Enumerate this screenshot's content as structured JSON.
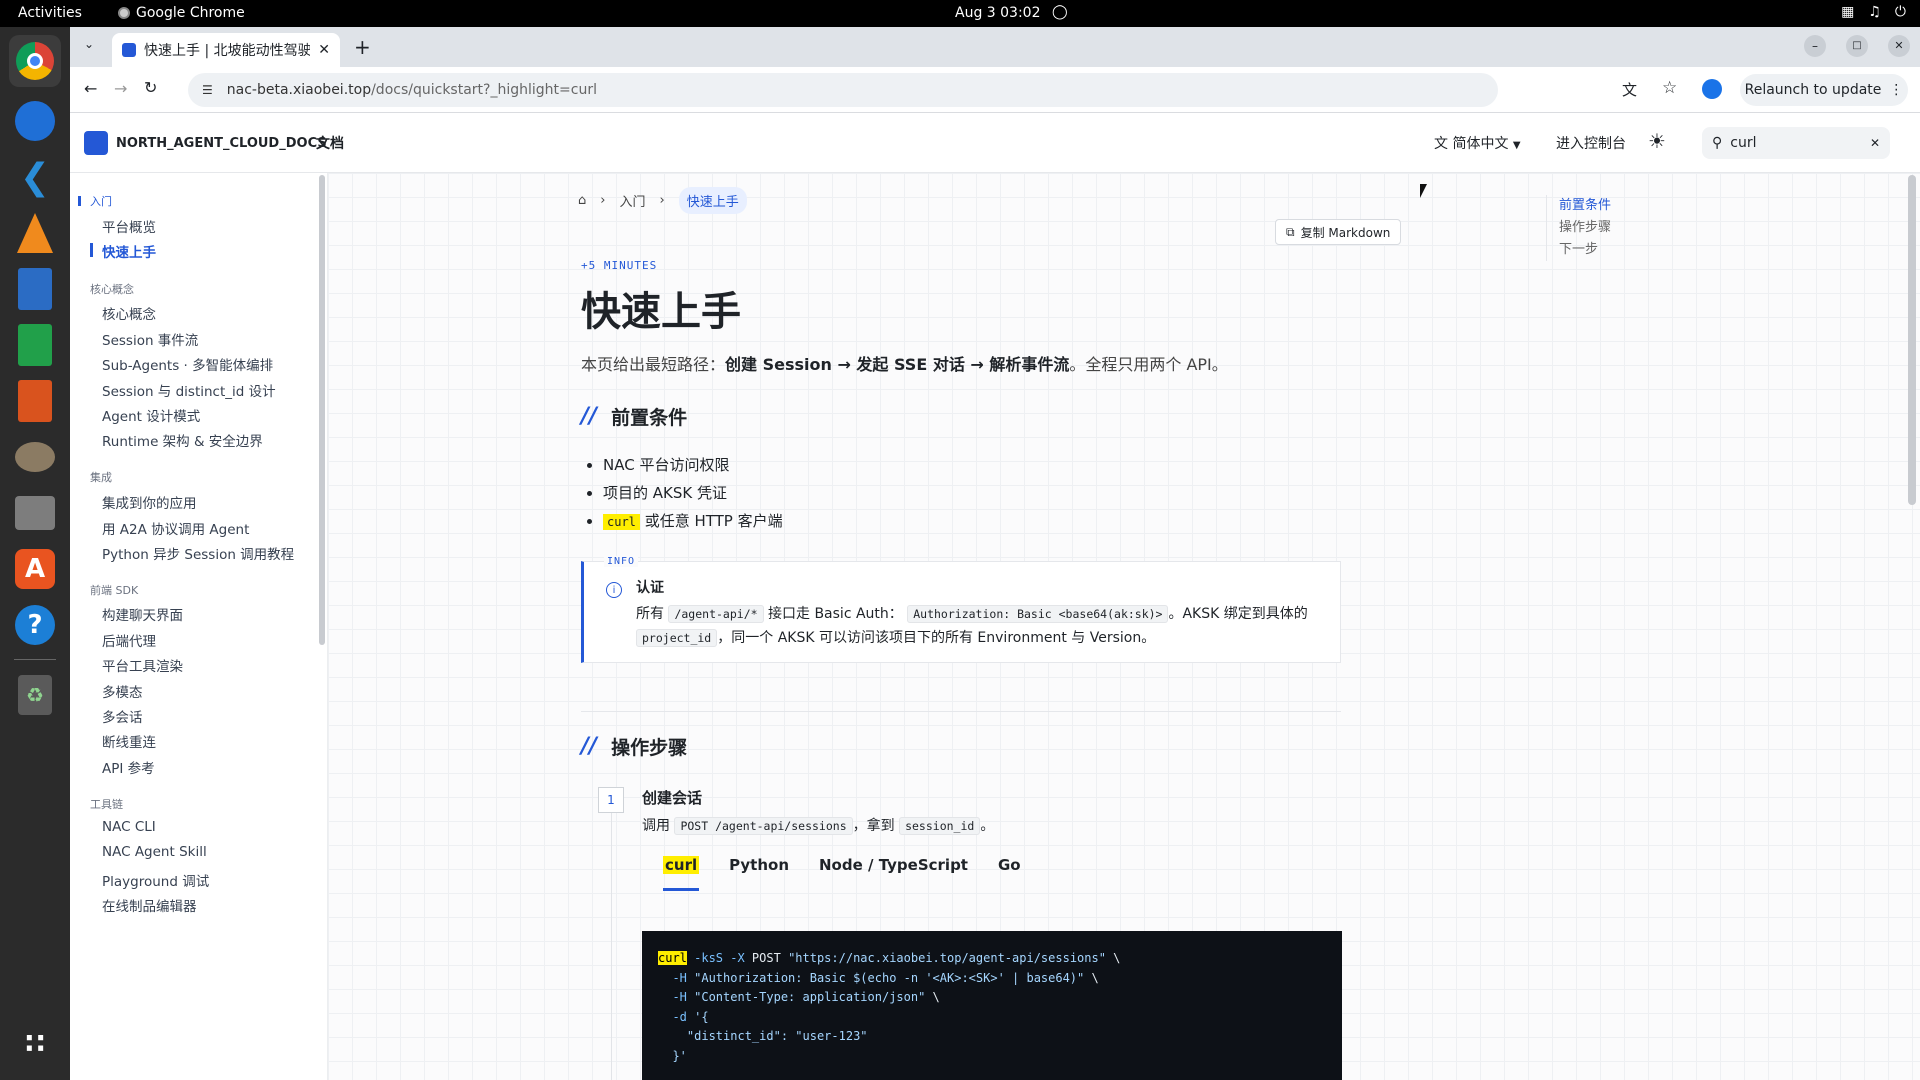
{
  "os": {
    "activities": "Activities",
    "active_app": "Google Chrome",
    "clock": "Aug 3  03:02"
  },
  "dock": {
    "items": [
      "chrome-icon",
      "thunderbird-icon",
      "vscode-icon",
      "vlc-icon",
      "writer-icon",
      "calc-icon",
      "impress-icon",
      "gimp-icon",
      "files-icon",
      "app-center-icon",
      "help-icon",
      "trash-icon",
      "show-apps-icon"
    ]
  },
  "browser": {
    "tab_title": "快速上手 | 北坡能动性驾驶",
    "url_host": "nac-beta.xiaobei.top",
    "url_path": "/docs/quickstart?_highlight=curl",
    "relaunch_label": "Relaunch to update"
  },
  "header": {
    "brand": "NORTH_AGENT_CLOUD_DOCS",
    "nav_docs": "文档",
    "language": "简体中文",
    "console": "进入控制台",
    "search_value": "curl"
  },
  "sidebar": {
    "groups": [
      {
        "title": "入门",
        "items": [
          "平台概览",
          "快速上手"
        ]
      },
      {
        "title": "核心概念",
        "items": [
          "核心概念",
          "Session 事件流",
          "Sub-Agents · 多智能体编排",
          "Session 与 distinct_id 设计",
          "Agent 设计模式",
          "Runtime 架构 & 安全边界"
        ]
      },
      {
        "title": "集成",
        "items": [
          "集成到你的应用",
          "用 A2A 协议调用 Agent",
          "Python 异步 Session 调用教程"
        ]
      },
      {
        "title": "前端 SDK",
        "items": [
          "构建聊天界面",
          "后端代理",
          "平台工具渲染",
          "多模态",
          "多会话",
          "断线重连",
          "API 参考"
        ]
      },
      {
        "title": "工具链",
        "items": [
          "NAC CLI",
          "NAC Agent Skill",
          "Playground 调试",
          "在线制品编辑器"
        ]
      }
    ]
  },
  "breadcrumb": {
    "level1": "入门",
    "current": "快速上手"
  },
  "copy_markdown": "复制 Markdown",
  "toc": [
    "前置条件",
    "操作步骤",
    "下一步"
  ],
  "article": {
    "eyebrow": "+5 MINUTES",
    "title": "快速上手",
    "lede_prefix": "本页给出最短路径：",
    "lede_bold": "创建 Session → 发起 SSE 对话 → 解析事件流",
    "lede_suffix": "。全程只用两个 API。",
    "section1": "前置条件",
    "bullets": [
      "NAC 平台访问权限",
      "项目的 AKSK 凭证",
      "或任意 HTTP 客户端"
    ],
    "bullet3_code": "curl",
    "info": {
      "tag": "INFO",
      "title": "认证",
      "p1": "所有",
      "c1": "/agent-api/*",
      "p2": "接口走 Basic Auth：",
      "c2": "Authorization: Basic <base64(ak:sk)>",
      "p3": "。AKSK 绑定到具体的",
      "c3": "project_id",
      "p4": "，同一个 AKSK 可以访问该项目下的所有 Environment 与 Version。"
    },
    "section2": "操作步骤",
    "step1": {
      "num": "1",
      "title": "创建会话",
      "d1": "调用",
      "c1": "POST /agent-api/sessions",
      "d2": "，拿到",
      "c2": "session_id",
      "d3": "。"
    },
    "code_tabs": [
      "curl",
      "Python",
      "Node / TypeScript",
      "Go"
    ],
    "code": {
      "l1_cmd": "curl",
      "l1_flags": " -ksS -X",
      "l1_rest": " POST ",
      "l1_url": "\"https://nac.xiaobei.top/agent-api/sessions\"",
      "l1_end": " \\",
      "l2_flag": "  -H",
      "l2_str": " \"Authorization: Basic $(echo -n '<AK>:<SK>' | base64)\"",
      "l2_end": " \\",
      "l3_flag": "  -H",
      "l3_str": " \"Content-Type: application/json\"",
      "l3_end": " \\",
      "l4_flag": "  -d",
      "l4_str": " '{",
      "l5": "    \"distinct_id\": \"user-123\"",
      "l6": "  }'"
    }
  },
  "colors": {
    "accent": "#2458d6",
    "highlight": "#ffee00",
    "code_bg": "#0d1117"
  }
}
